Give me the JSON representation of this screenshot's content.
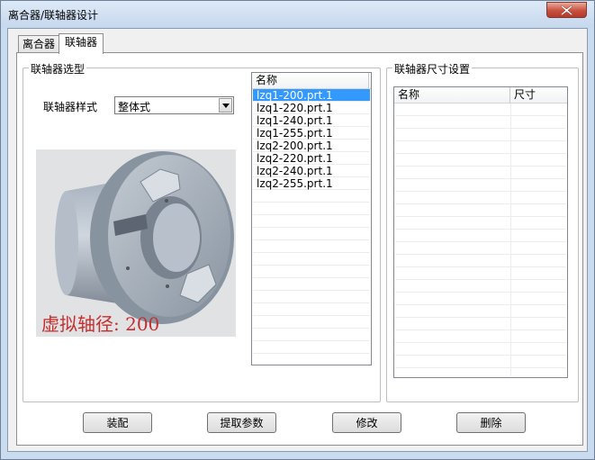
{
  "window": {
    "title": "离合器/联轴器设计"
  },
  "tabs": [
    {
      "label": "离合器",
      "active": false
    },
    {
      "label": "联轴器",
      "active": true
    }
  ],
  "selection_group": {
    "legend": "联轴器选型",
    "style_label": "联轴器样式",
    "style_value": "整体式",
    "preview_caption": "虚拟轴径: 200"
  },
  "parts_list": {
    "header": "名称",
    "items": [
      "lzq1-200.prt.1",
      "lzq1-220.prt.1",
      "lzq1-240.prt.1",
      "lzq1-255.prt.1",
      "lzq2-200.prt.1",
      "lzq2-220.prt.1",
      "lzq2-240.prt.1",
      "lzq2-255.prt.1"
    ],
    "selected_index": 0
  },
  "dimension_group": {
    "legend": "联轴器尺寸设置",
    "col_name": "名称",
    "col_size": "尺寸"
  },
  "buttons": {
    "assemble": "装配",
    "extract": "提取参数",
    "modify": "修改",
    "delete": "删除"
  },
  "colors": {
    "selection": "#3399ff",
    "caption": "#c62e2e",
    "close": "#c8503f"
  }
}
